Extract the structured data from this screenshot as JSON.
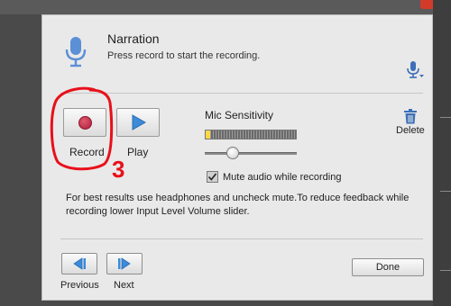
{
  "header": {
    "title": "Narration",
    "subtitle": "Press record to start the recording."
  },
  "controls": {
    "record_label": "Record",
    "play_label": "Play",
    "delete_label": "Delete"
  },
  "mic": {
    "label": "Mic Sensitivity",
    "level_fraction": 0.05,
    "sensitivity_fraction": 0.3,
    "mute_label": "Mute audio while recording",
    "mute_checked": true
  },
  "info": "For best results use headphones and uncheck mute.To reduce feedback while recording lower Input Level Volume slider.",
  "nav": {
    "previous_label": "Previous",
    "next_label": "Next",
    "done_label": "Done"
  },
  "annotation": {
    "text": "3",
    "color": "#e8101a"
  },
  "colors": {
    "accent": "#3c8ad8",
    "record": "#c0243f",
    "level": "#ffd84a"
  }
}
